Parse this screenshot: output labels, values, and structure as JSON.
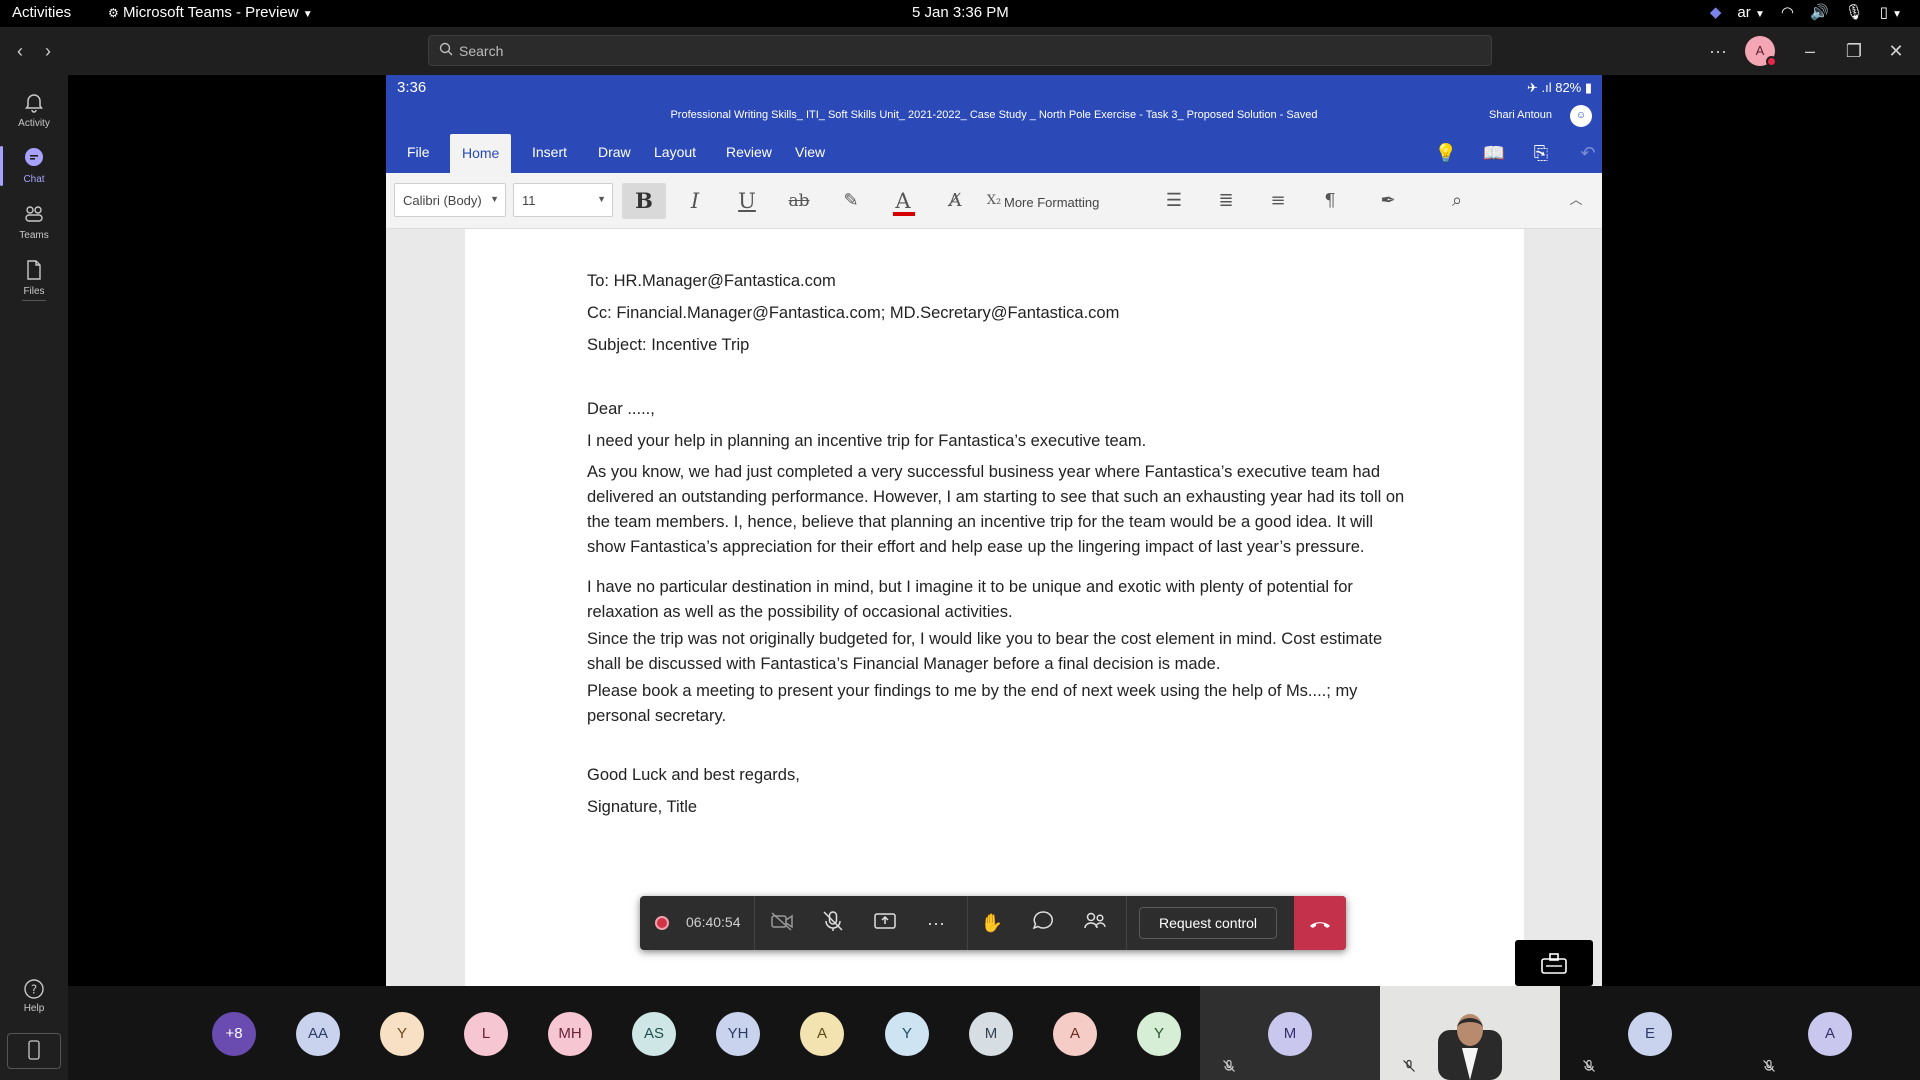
{
  "topbar": {
    "activities": "Activities",
    "app_menu": "Microsoft Teams - Preview",
    "clock": "5 Jan  3:36 PM",
    "keyboard_layout": "ar"
  },
  "titlebar": {
    "search_placeholder": "Search",
    "avatar_initial": "A"
  },
  "rail": {
    "items": [
      {
        "label": "Activity"
      },
      {
        "label": "Chat"
      },
      {
        "label": "Teams"
      },
      {
        "label": "Files"
      }
    ],
    "help": "Help"
  },
  "shared_screen": {
    "phone_time": "3:36",
    "phone_status": "✈ .ıl 82% ▮",
    "doc_title": "Professional Writing Skills_ ITI_ Soft Skills Unit_ 2021-2022_ Case Study _ North Pole Exercise - Task 3_ Proposed Solution - Saved",
    "user_name": "Shari Antoun",
    "tabs": [
      "File",
      "Home",
      "Insert",
      "Draw",
      "Layout",
      "Review",
      "View"
    ],
    "active_tab": "Home",
    "font_name": "Calibri (Body)",
    "font_size": "11",
    "more_formatting": "More Formatting",
    "document": {
      "to": "To: HR.Manager@Fantastica.com",
      "cc": "Cc: Financial.Manager@Fantastica.com; MD.Secretary@Fantastica.com",
      "subject": "Subject: Incentive Trip",
      "salutation": "Dear .....,",
      "p1": "I need your help in planning an incentive trip for Fantastica’s executive team.",
      "p2": "As you know, we had just completed a very successful business year where Fantastica’s executive team had delivered an outstanding performance. However, I am starting to see that such an exhausting year had its toll on the team members. I, hence, believe that planning an incentive trip for the team would be a good idea. It will show Fantastica’s appreciation for their effort and help ease up the lingering impact of last year’s pressure.",
      "p3": "I have no particular destination in mind, but I imagine it to be unique and exotic with plenty of potential for relaxation as well as the possibility of occasional activities.",
      "p4": "Since the trip was not originally budgeted for, I would like you to bear the cost element in mind. Cost estimate shall be discussed with Fantastica’s Financial Manager before a final decision is made.",
      "p5": "Please book a meeting to present your findings to me by the end of next week using the help of Ms....; my personal secretary.",
      "closing": "Good Luck and best regards,",
      "signature": "Signature, Title"
    }
  },
  "call": {
    "timer": "06:40:54",
    "request_control": "Request control"
  },
  "participants": [
    {
      "initials": "+8",
      "bg": "#6a4bb0",
      "fg": "#ffffff"
    },
    {
      "initials": "AA",
      "bg": "#c9d3ee",
      "fg": "#2e3b66"
    },
    {
      "initials": "Y",
      "bg": "#f7e0c4",
      "fg": "#6b4a1e"
    },
    {
      "initials": "L",
      "bg": "#f6c6d3",
      "fg": "#6e2238"
    },
    {
      "initials": "MH",
      "bg": "#f6c6d3",
      "fg": "#6e2238"
    },
    {
      "initials": "AS",
      "bg": "#cfe6e6",
      "fg": "#1f4f4f"
    },
    {
      "initials": "YH",
      "bg": "#c9d3ee",
      "fg": "#2e3b66"
    },
    {
      "initials": "A",
      "bg": "#f3e3b0",
      "fg": "#5e4b12"
    },
    {
      "initials": "Y",
      "bg": "#cfe4f3",
      "fg": "#1f4a66"
    },
    {
      "initials": "M",
      "bg": "#d6dde3",
      "fg": "#34424f"
    },
    {
      "initials": "A",
      "bg": "#f6cdc6",
      "fg": "#6e2a1f"
    },
    {
      "initials": "Y",
      "bg": "#d6eed6",
      "fg": "#265a26"
    }
  ],
  "tiles": [
    {
      "initials": "M",
      "bg": "#c9c7ee",
      "fg": "#33306b"
    },
    {
      "initials": "E",
      "bg": "#c9d3ee",
      "fg": "#2e3b66"
    },
    {
      "initials": "A",
      "bg": "#c9c7ee",
      "fg": "#33306b"
    }
  ]
}
